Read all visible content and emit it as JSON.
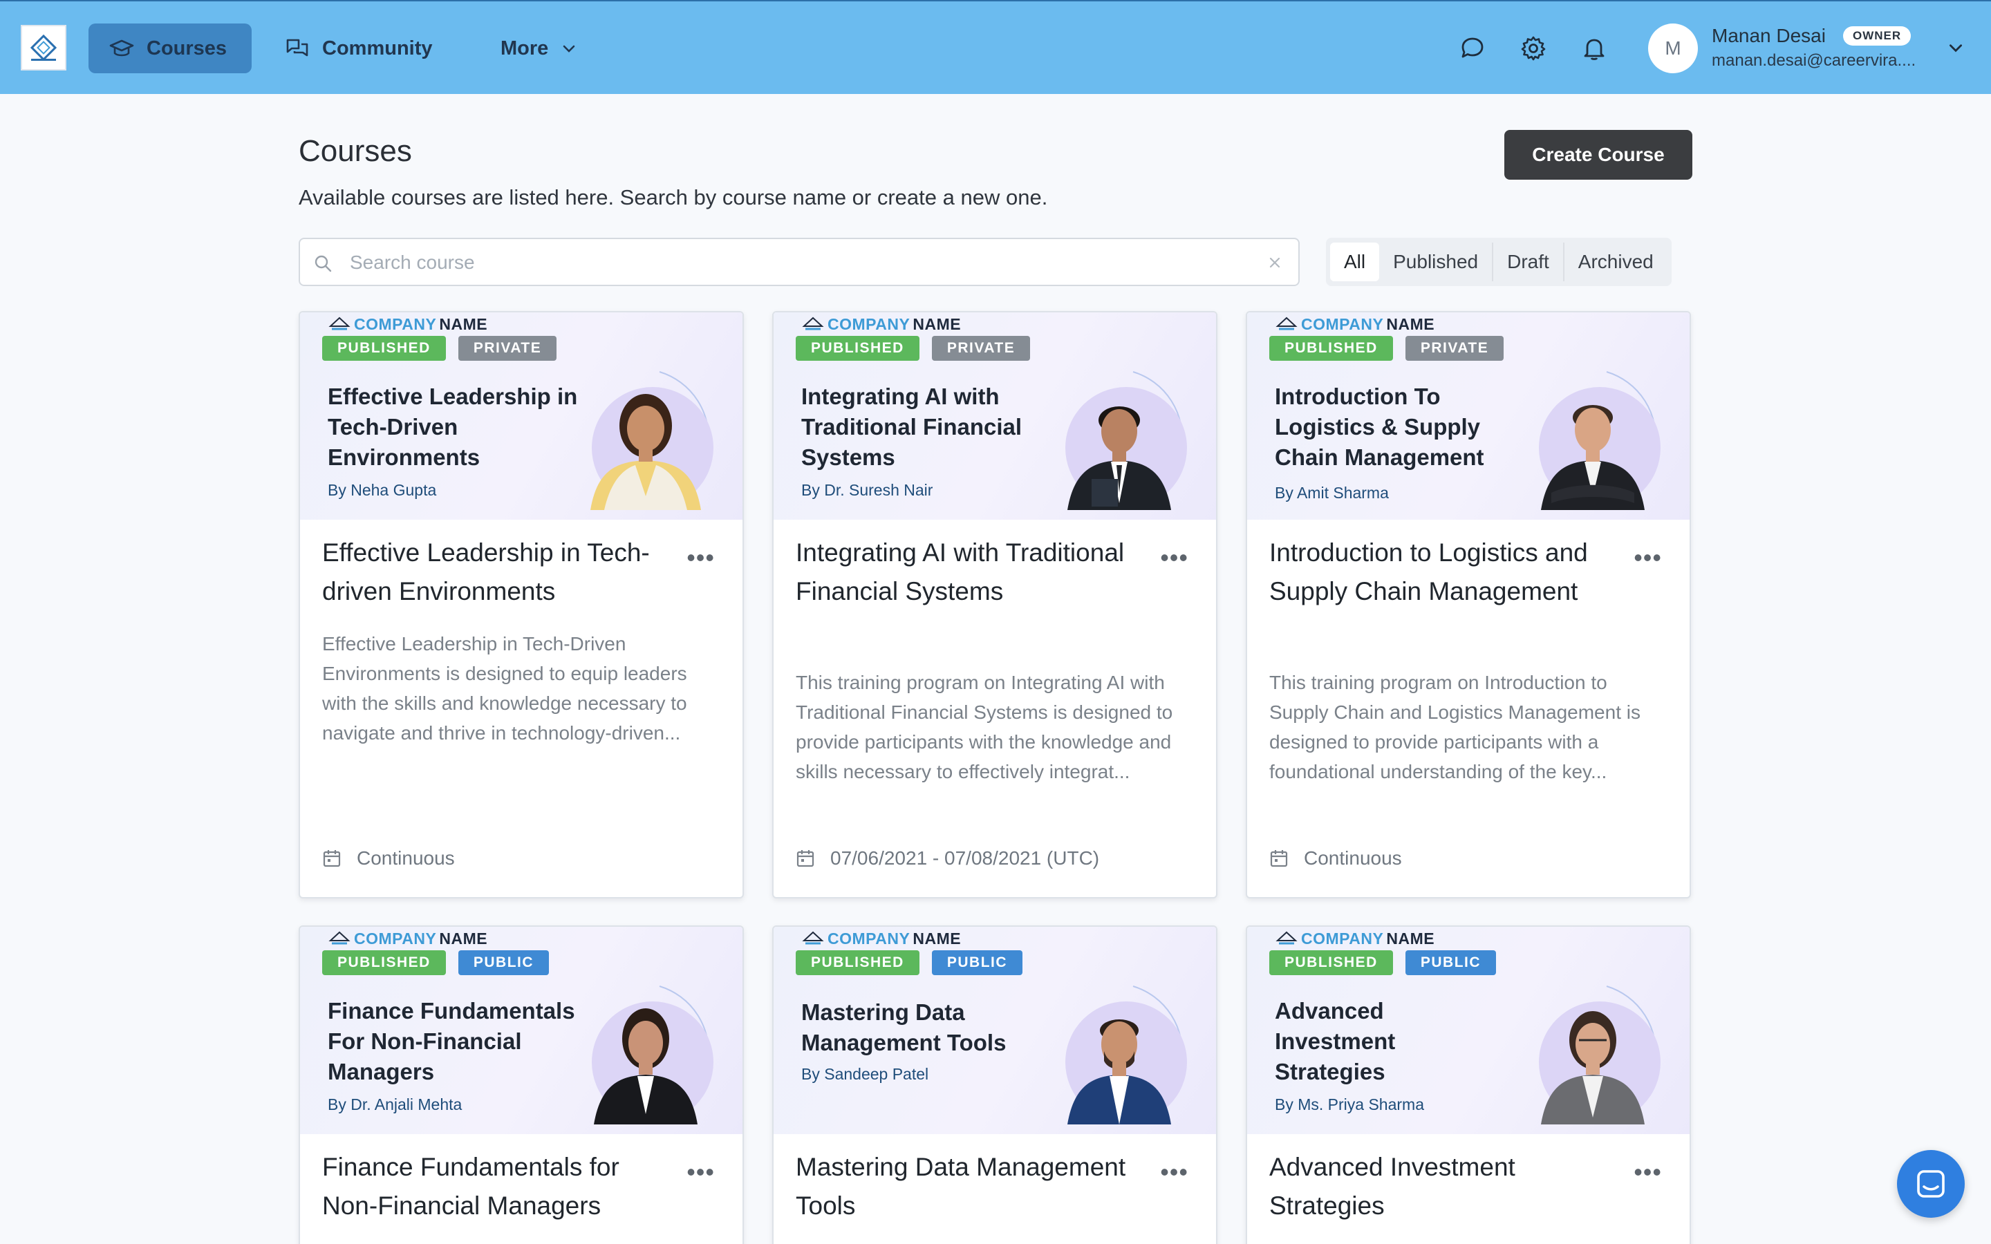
{
  "nav": {
    "logo_text": "COMPANY NAME",
    "items": [
      {
        "label": "Courses",
        "icon": "graduation-cap-icon"
      },
      {
        "label": "Community",
        "icon": "chat-bubbles-icon"
      },
      {
        "label": "More",
        "icon": "chevron-down-icon"
      }
    ],
    "user": {
      "initial": "M",
      "name": "Manan Desai",
      "role": "OWNER",
      "email": "manan.desai@careervira...."
    }
  },
  "page": {
    "title": "Courses",
    "subtitle": "Available courses are listed here. Search by course name or create a new one.",
    "create_button": "Create Course"
  },
  "search": {
    "placeholder": "Search course",
    "value": ""
  },
  "filters": [
    "All",
    "Published",
    "Draft",
    "Archived"
  ],
  "active_filter": "All",
  "brand": {
    "company": "COMPANY",
    "name": "NAME"
  },
  "courses": [
    {
      "status": "PUBLISHED",
      "visibility": "PRIVATE",
      "banner_title": "Effective Leadership in Tech-Driven Environments",
      "author": "By Neha Gupta",
      "title": "Effective Leadership in Tech-driven Environments",
      "description": "Effective Leadership in Tech-Driven Environments is designed to equip leaders with the skills and knowledge necessary to navigate and thrive in technology-driven...",
      "date": "Continuous"
    },
    {
      "status": "PUBLISHED",
      "visibility": "PRIVATE",
      "banner_title": "Integrating AI with Traditional Financial Systems",
      "author": "By Dr. Suresh Nair",
      "title": "Integrating AI with Traditional Financial Systems",
      "description": "This training program on Integrating AI with Traditional Financial Systems is designed to provide participants with the knowledge and skills necessary to effectively integrat...",
      "date": "07/06/2021 - 07/08/2021 (UTC)"
    },
    {
      "status": "PUBLISHED",
      "visibility": "PRIVATE",
      "banner_title": "Introduction To Logistics & Supply Chain Management",
      "author": "By Amit Sharma",
      "title": "Introduction to Logistics and Supply Chain Management",
      "description": "This training program on Introduction to Supply Chain and Logistics Management is designed to provide participants with a foundational understanding of the key...",
      "date": "Continuous"
    },
    {
      "status": "PUBLISHED",
      "visibility": "PUBLIC",
      "banner_title": "Finance Fundamentals For Non-Financial Managers",
      "author": "By Dr. Anjali Mehta",
      "title": "Finance Fundamentals for Non-Financial Managers"
    },
    {
      "status": "PUBLISHED",
      "visibility": "PUBLIC",
      "banner_title": "Mastering Data Management Tools",
      "author": "By Sandeep Patel",
      "title": "Mastering Data Management Tools"
    },
    {
      "status": "PUBLISHED",
      "visibility": "PUBLIC",
      "banner_title": "Advanced Investment Strategies",
      "author": "By Ms. Priya Sharma",
      "title": "Advanced Investment Strategies"
    }
  ],
  "colors": {
    "topbar": "#6bbbef",
    "nav_active": "#3f86c3",
    "published": "#5cb85c",
    "private": "#858c94",
    "public": "#3f8ad4",
    "primary_button": "#3b3d40",
    "chat_launcher": "#2f7fe0"
  }
}
